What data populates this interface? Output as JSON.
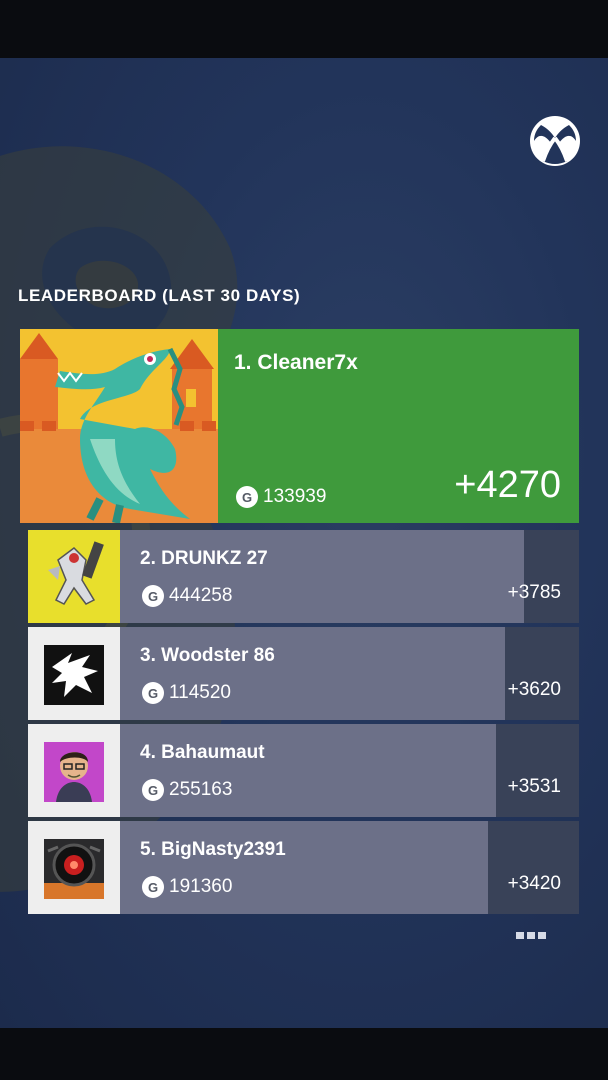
{
  "header": {
    "title": "LEADERBOARD (LAST 30 DAYS)",
    "logo_icon": "xbox-logo-icon"
  },
  "leaderboard": {
    "first": {
      "rank_name": "1. Cleaner7x",
      "gamerscore": "133939",
      "delta": "+4270",
      "badge": "G",
      "avatar_icon": "dragon-castle-avatar",
      "tile_color": "#3f9a3c"
    },
    "entries": [
      {
        "rank_name": "2. DRUNKZ 27",
        "gamerscore": "444258",
        "delta": "+3785",
        "badge": "G",
        "avatar_icon": "mech-robot-avatar",
        "progress": 0.9
      },
      {
        "rank_name": "3. Woodster 86",
        "gamerscore": "114520",
        "delta": "+3620",
        "badge": "G",
        "avatar_icon": "dragon-emblem-avatar",
        "progress": 0.865
      },
      {
        "rank_name": "4. Bahaumaut",
        "gamerscore": "255163",
        "delta": "+3531",
        "badge": "G",
        "avatar_icon": "person-avatar",
        "progress": 0.85
      },
      {
        "rank_name": "5. BigNasty2391",
        "gamerscore": "191360",
        "delta": "+3420",
        "badge": "G",
        "avatar_icon": "robot-eye-avatar",
        "progress": 0.835
      }
    ],
    "more_icon": "more-options-icon"
  },
  "colors": {
    "background": "#22345a",
    "row_fill": "#6c7088",
    "row_track": "#394258"
  }
}
